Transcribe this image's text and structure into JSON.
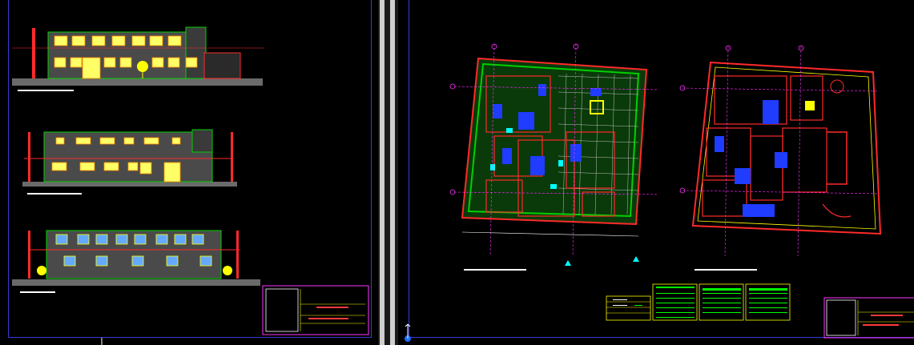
{
  "app": {
    "window_title": "",
    "background": "#000000"
  },
  "colors": {
    "frame": "#3a3ad8",
    "wall": "#ff2a2a",
    "hatch": "#00d000",
    "furniture": "#1f3cff",
    "text": "#ffff00",
    "axis": "#ff33ff",
    "grid": "#d8d8d8"
  },
  "left_layout": {
    "views": [
      {
        "id": "elevation-1",
        "label": ""
      },
      {
        "id": "elevation-2",
        "label": ""
      },
      {
        "id": "elevation-3",
        "label": ""
      }
    ],
    "title_block": {
      "lines": [
        "",
        "",
        ""
      ]
    }
  },
  "right_layout": {
    "plans": [
      {
        "id": "plan-ground",
        "label": ""
      },
      {
        "id": "plan-upper",
        "label": ""
      }
    ],
    "schedules": [
      {
        "id": "schedule-1",
        "rows": 6
      },
      {
        "id": "schedule-2",
        "rows": 12
      },
      {
        "id": "schedule-3",
        "rows": 12
      },
      {
        "id": "schedule-4",
        "rows": 12
      }
    ],
    "title_block": {
      "lines": [
        "",
        "",
        ""
      ]
    }
  },
  "ucs_icon": "ucs-icon"
}
